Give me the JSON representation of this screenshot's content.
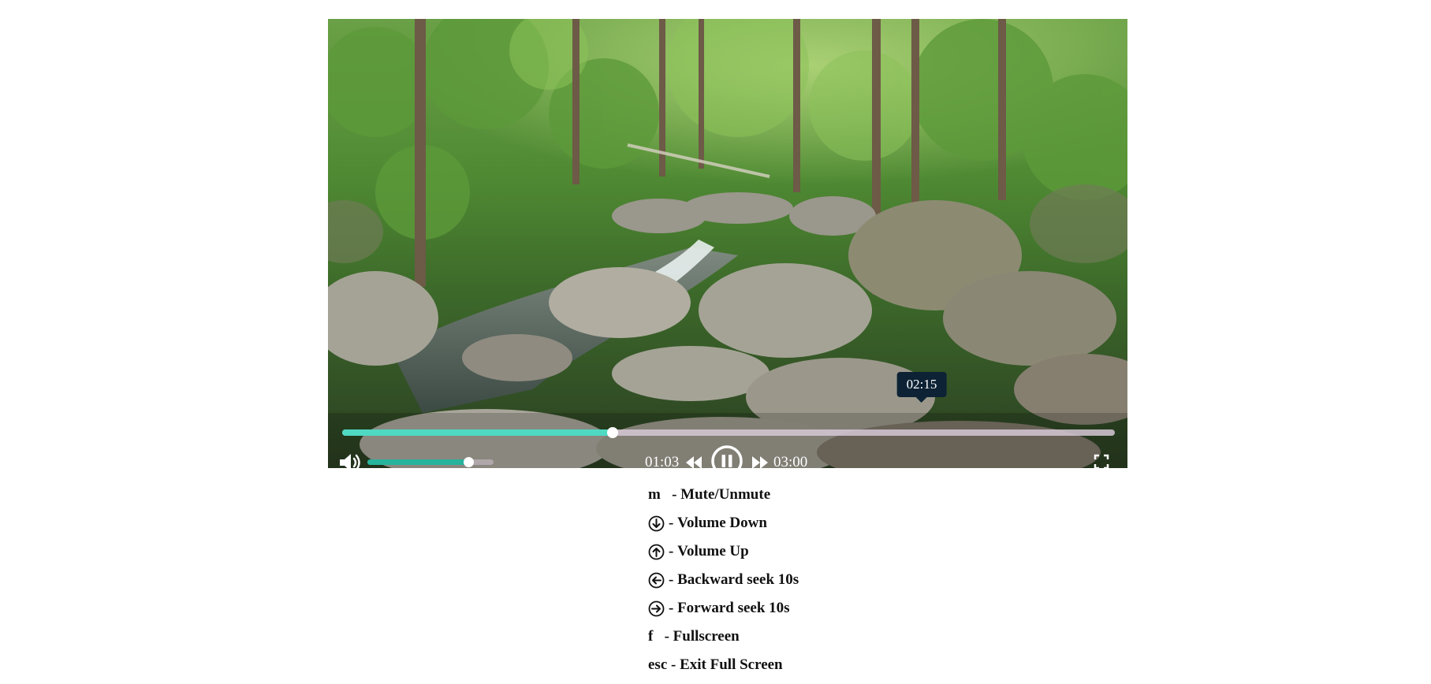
{
  "player": {
    "progress": {
      "current_fraction": 0.35,
      "hover_fraction": 0.75
    },
    "hover_time": "02:15",
    "current_time": "01:03",
    "total_time": "03:00",
    "volume_fraction": 0.8,
    "accent": "#4fd9c3",
    "volume_accent": "#27b39c",
    "tooltip_bg": "#0d2235",
    "state": "playing",
    "icons": {
      "volume": "volume-icon",
      "rewind": "rewind-icon",
      "pause": "pause-icon",
      "forward": "fast-forward-icon",
      "fullscreen": "fullscreen-icon"
    }
  },
  "shortcuts": [
    {
      "key": "m",
      "icon": null,
      "sep": "   - ",
      "label": "Mute/Unmute"
    },
    {
      "key": null,
      "icon": "arrow-down-icon",
      "sep": "- ",
      "label": "Volume Down"
    },
    {
      "key": null,
      "icon": "arrow-up-icon",
      "sep": "- ",
      "label": "Volume Up"
    },
    {
      "key": null,
      "icon": "arrow-left-icon",
      "sep": "- ",
      "label": "Backward seek 10s"
    },
    {
      "key": null,
      "icon": "arrow-right-icon",
      "sep": "- ",
      "label": "Forward seek 10s"
    },
    {
      "key": "f",
      "icon": null,
      "sep": "   - ",
      "label": "Fullscreen"
    },
    {
      "key": "esc",
      "icon": null,
      "sep": " - ",
      "label": "Exit Full Screen"
    }
  ]
}
